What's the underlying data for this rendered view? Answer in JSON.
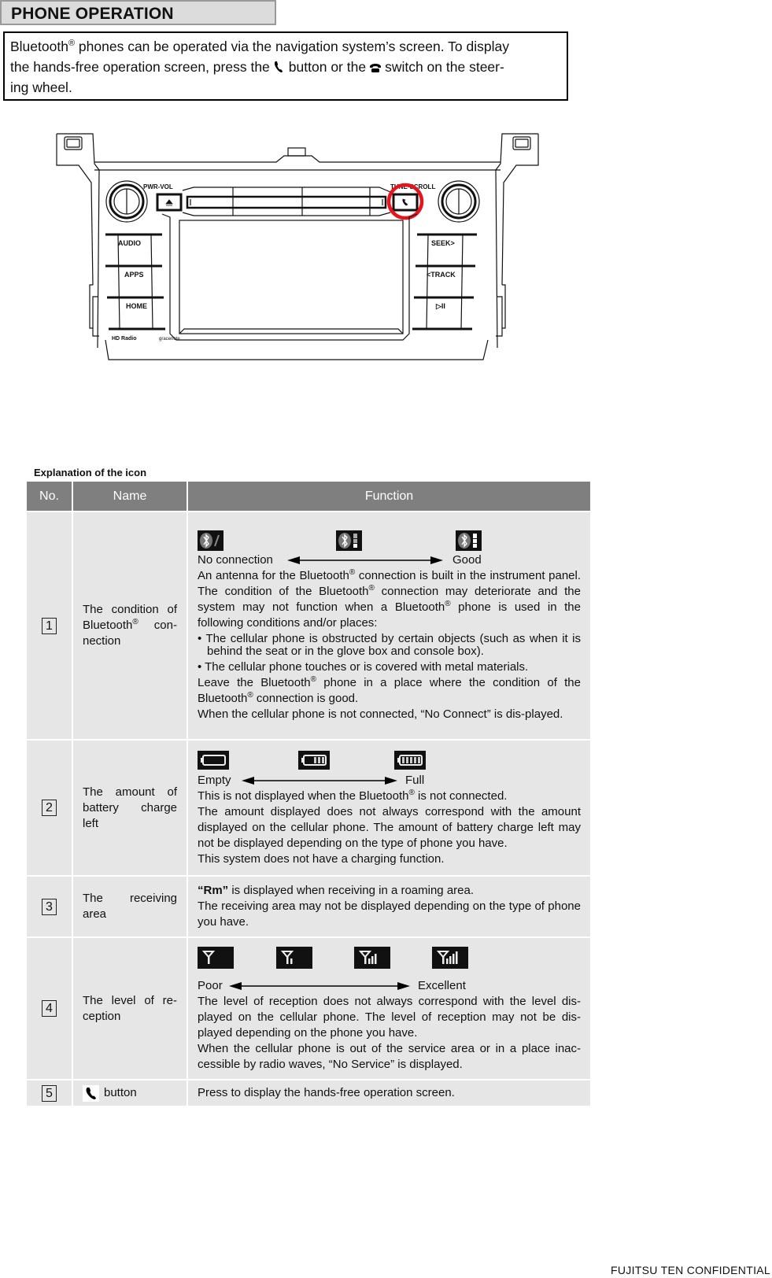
{
  "header": {
    "title": "PHONE OPERATION"
  },
  "intro": {
    "line1_pre": "Bluetooth",
    "reg": "®",
    "line1_post": " phones can be operated via the navigation system’s screen. To display",
    "line2_pre": "the hands-free operation screen, press the",
    "line2_mid": "button or the",
    "line2_post": "switch on the steer-",
    "line3": "ing wheel.",
    "button_icon": "phone-handset-icon",
    "switch_icon": "steering-phone-switch-icon"
  },
  "diagram": {
    "labels": {
      "pwr_vol": "PWR-VOL",
      "tune_scroll": "TUNE·SCROLL",
      "audio": "AUDIO",
      "apps": "APPS",
      "home": "HOME",
      "seek": "SEEK>",
      "track": "<TRACK",
      "play_pause": "▷II",
      "hd_radio": "HD Radio",
      "gracenote": "gracenote"
    },
    "highlight": "phone-button",
    "highlight_color": "#e8141c"
  },
  "table": {
    "section_label": "Explanation of the icon",
    "columns": [
      "No.",
      "Name",
      "Function"
    ],
    "header_color": "#7f7f7f",
    "row_color": "#e6e6e6",
    "rows": [
      {
        "no": "1",
        "name_pre": "The condition of Bluetooth",
        "name_post": " con-nection",
        "icons": [
          "bluetooth-no-connection-icon",
          "bluetooth-medium-icon",
          "bluetooth-good-icon"
        ],
        "scale_left": "No connection",
        "scale_right": "Good",
        "p1a": "An antenna for the Bluetooth",
        "p1b": " connection is built in the instrument panel. The condition of the Bluetooth",
        "p1c": " connection may deteriorate and the system may not function when a Bluetooth",
        "p1d": " phone is used in the following conditions and/or places:",
        "bullet1": "• The cellular phone is obstructed by certain objects (such as when it is behind the seat or in the glove box and console box).",
        "bullet2": "• The cellular phone touches or is covered with metal materials.",
        "p2a": "Leave the Bluetooth",
        "p2b": " phone in a place where the condition of the Bluetooth",
        "p2c": " connection is good.",
        "p3": "When the cellular phone is not connected, “No Connect” is dis-played."
      },
      {
        "no": "2",
        "name": "The amount of battery charge left",
        "icons": [
          "battery-empty-icon",
          "battery-half-icon",
          "battery-full-icon"
        ],
        "scale_left": "Empty",
        "scale_right": "Full",
        "p1a": "This is not displayed when the Bluetooth",
        "p1b": " is not connected.",
        "p2": "The amount displayed does not always correspond with the amount displayed on the cellular phone. The amount of battery charge left may not be displayed depending on the type of phone you have.",
        "p3": "This system does not have a charging function."
      },
      {
        "no": "3",
        "name": "The receiving area",
        "rm": "“Rm”",
        "p1": " is displayed when receiving in a roaming area.",
        "p2": "The receiving area may not be displayed depending on the type of phone you have."
      },
      {
        "no": "4",
        "name": "The level of re-ception",
        "icons": [
          "signal-0-bars-icon",
          "signal-1-bar-icon",
          "signal-3-bars-icon",
          "signal-4-bars-icon"
        ],
        "scale_left": "Poor",
        "scale_right": "Excellent",
        "p1": "The level of reception does not always correspond with the level dis-played on the cellular phone. The level of reception may not be dis-played depending on the phone you have.",
        "p2": "When the cellular phone is out of the service area or in a place inac-cessible by radio waves, “No Service” is displayed."
      },
      {
        "no": "5",
        "name_icon": "phone-handset-icon",
        "name": "button",
        "function": "Press to display the hands-free operation screen."
      }
    ]
  },
  "footer": {
    "text": "FUJITSU TEN CONFIDENTIAL"
  }
}
